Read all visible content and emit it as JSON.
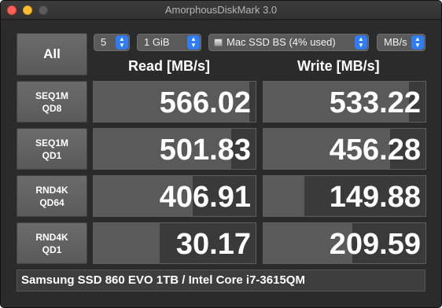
{
  "window": {
    "title": "AmorphousDiskMark 3.0"
  },
  "controls": {
    "all_label": "All",
    "count": "5",
    "size": "1 GiB",
    "drive": "Mac SSD BS (4% used)",
    "unit": "MB/s",
    "stepper_up": "▲",
    "stepper_down": "▼"
  },
  "headers": {
    "read": "Read [MB/s]",
    "write": "Write [MB/s]"
  },
  "tests": [
    {
      "line1": "SEQ1M",
      "line2": "QD8",
      "read": "566.02",
      "write": "533.22",
      "read_fraction": 0.96,
      "write_fraction": 0.9
    },
    {
      "line1": "SEQ1M",
      "line2": "QD1",
      "read": "501.83",
      "write": "456.28",
      "read_fraction": 0.85,
      "write_fraction": 0.78
    },
    {
      "line1": "RND4K",
      "line2": "QD64",
      "read": "406.91",
      "write": "149.88",
      "read_fraction": 0.61,
      "write_fraction": 0.25
    },
    {
      "line1": "RND4K",
      "line2": "QD1",
      "read": "30.17",
      "write": "209.59",
      "read_fraction": 0.41,
      "write_fraction": 0.55
    }
  ],
  "footer": {
    "device": "Samsung SSD 860 EVO 1TB / Intel Core i7-3615QM"
  }
}
